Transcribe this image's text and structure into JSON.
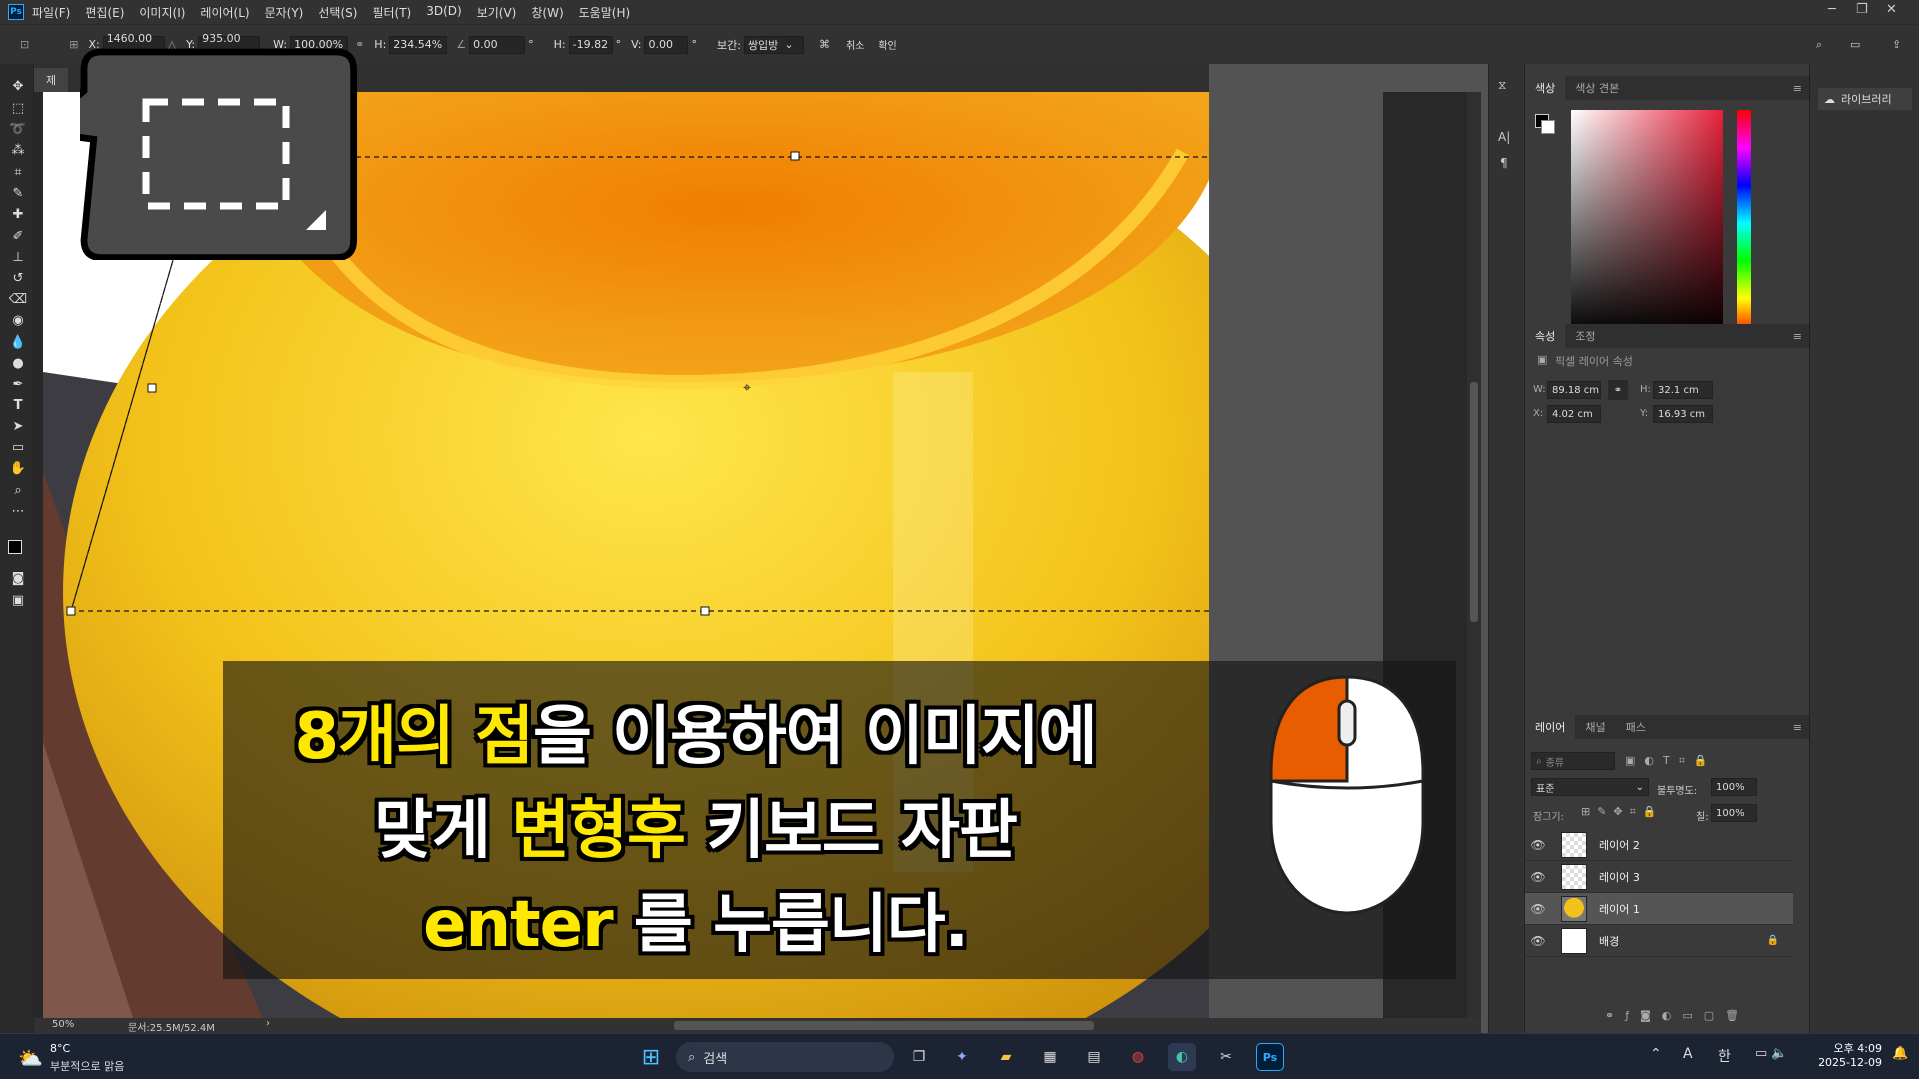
{
  "app": {
    "logo": "Ps"
  },
  "menu": [
    "파일(F)",
    "편집(E)",
    "이미지(I)",
    "레이어(L)",
    "문자(Y)",
    "선택(S)",
    "필터(T)",
    "3D(D)",
    "보기(V)",
    "창(W)",
    "도움말(H)"
  ],
  "options": {
    "x_label": "X:",
    "x_value": "1460.00 px",
    "y_label": "Y:",
    "y_value": "935.00 px",
    "w_label": "W:",
    "w_value": "100.00%",
    "h_label": "H:",
    "h_value": "234.54%",
    "angle_value": "0.00",
    "angle_unit": "°",
    "skew_h_label": "H:",
    "skew_h_value": "-19.82",
    "skew_v_label": "V:",
    "skew_v_value": "0.00",
    "interp_label": "보간:",
    "interp_value": "쌍입방",
    "cancel_label": "취소",
    "commit_label": "확인"
  },
  "document": {
    "tab_label": "제"
  },
  "status": {
    "zoom": "50%",
    "doc_info": "문서:25.5M/52.4M"
  },
  "color_panel": {
    "tabs": [
      "색상",
      "색상 견본"
    ]
  },
  "props_panel": {
    "tabs": [
      "속성",
      "조정"
    ],
    "title": "픽셀 레이어 속성",
    "w_label": "W:",
    "w_value": "89.18 cm",
    "h_label": "H:",
    "h_value": "32.1 cm",
    "x_label": "X:",
    "x_value": "4.02 cm",
    "y_label": "Y:",
    "y_value": "16.93 cm"
  },
  "layers_panel": {
    "tabs": [
      "레이어",
      "채널",
      "패스"
    ],
    "filter_placeholder": "종류",
    "blend_mode": "표준",
    "opacity_label": "불투명도:",
    "opacity_value": "100%",
    "lock_label": "잠그기:",
    "fill_label": "칠:",
    "fill_value": "100%",
    "layers": [
      {
        "name": "레이어 2",
        "selected": false
      },
      {
        "name": "레이어 3",
        "selected": false
      },
      {
        "name": "레이어 1",
        "selected": true
      },
      {
        "name": "배경",
        "selected": false,
        "locked": true
      }
    ]
  },
  "library": {
    "label": "라이브러리"
  },
  "caption": {
    "l1_a": "8개의 점",
    "l1_b": "을 이용하여 이미지에",
    "l2_a": "맞게 ",
    "l2_b": "변형후",
    "l2_c": " 키보드 자판",
    "l3_a": "enter",
    "l3_b": " 를 누릅니다."
  },
  "taskbar": {
    "weather_temp": "8°C",
    "weather_desc": "부분적으로 맑음",
    "search_placeholder": "검색",
    "ime_a": "A",
    "ime_b": "한",
    "time": "오후 4:09",
    "date": "2025-12-09"
  },
  "colors": {
    "accent": "#31a8ff",
    "highlight_text": "#ffe800",
    "mouse_button": "#e85d00",
    "selected_layer": "#555555"
  },
  "icons": [
    "move-icon",
    "marquee-icon",
    "lasso-icon",
    "magic-wand-icon",
    "crop-icon",
    "eyedropper-icon",
    "healing-icon",
    "brush-icon",
    "stamp-icon",
    "history-brush-icon",
    "eraser-icon",
    "paint-bucket-icon",
    "blur-icon",
    "dodge-icon",
    "pen-icon",
    "type-icon",
    "path-select-icon",
    "rectangle-icon",
    "hand-icon",
    "zoom-icon",
    "more-icon",
    "mouse-icon",
    "search-icon",
    "eye-icon",
    "lock-icon"
  ]
}
